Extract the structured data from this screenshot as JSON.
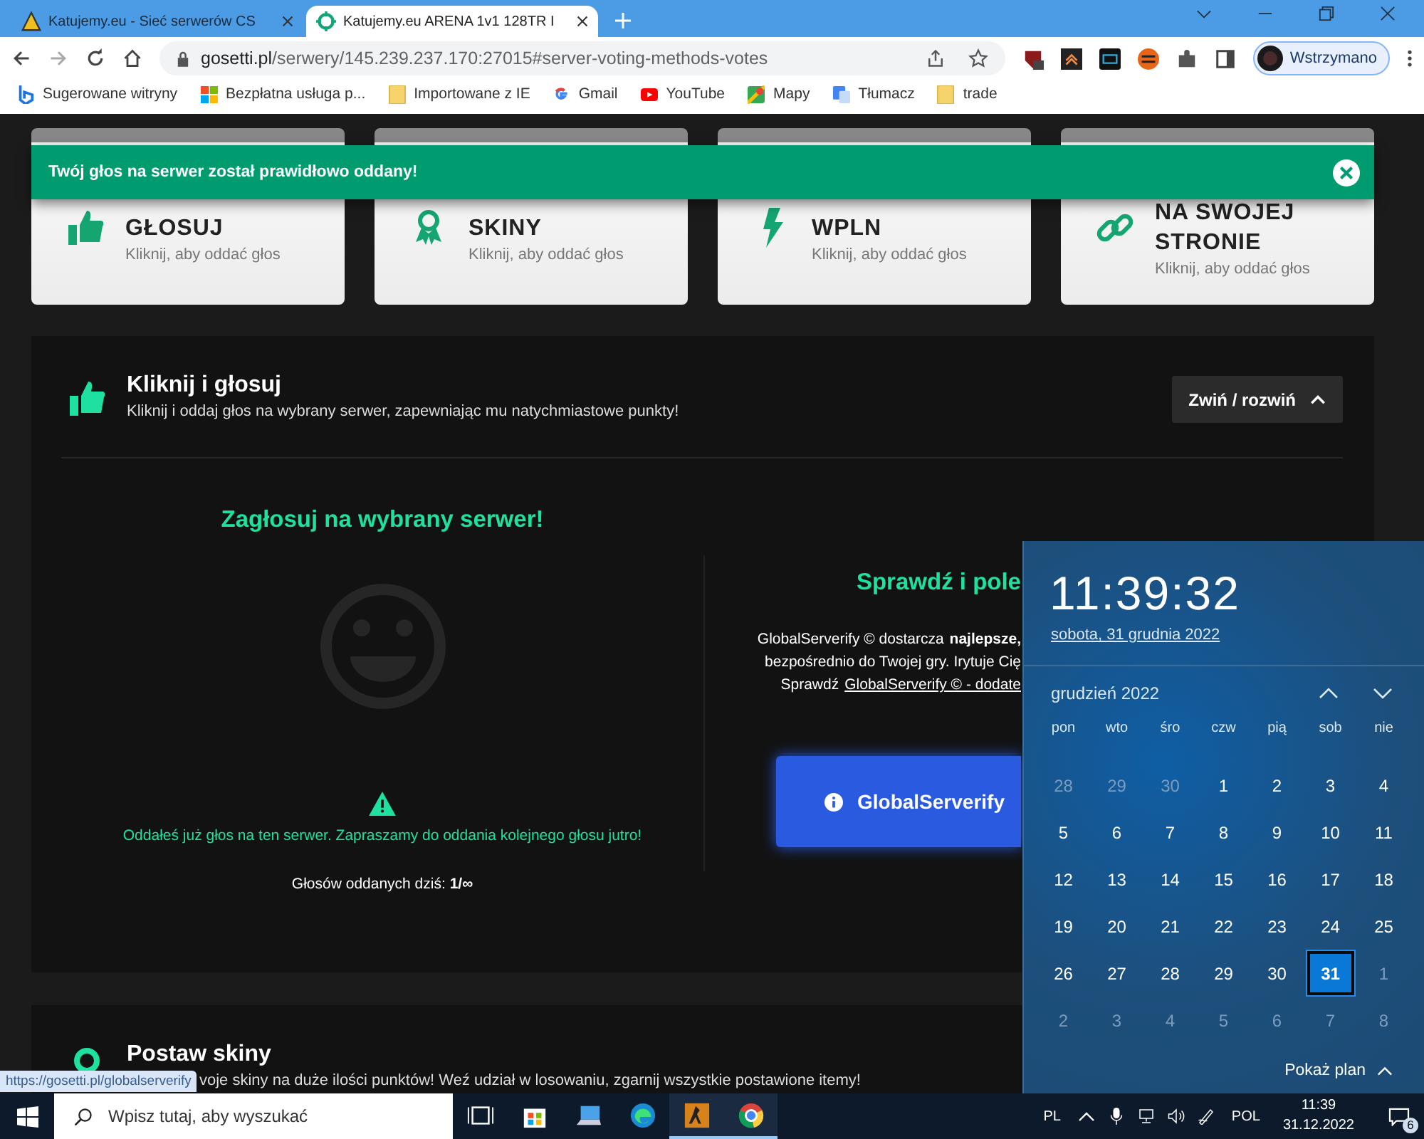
{
  "browser": {
    "tabs": [
      {
        "title": "Katujemy.eu - Sieć serwerów CS",
        "selected": false
      },
      {
        "title": "Katujemy.eu ARENA 1v1 128TR I",
        "selected": true
      }
    ],
    "url": {
      "host": "gosetti.pl",
      "path": "/serwery/145.239.237.170:27015#server-voting-methods-votes"
    },
    "profile": "Wstrzymano",
    "bookmarks": [
      "Sugerowane witryny",
      "Bezpłatna usługa p...",
      "Importowane z IE",
      "Gmail",
      "YouTube",
      "Mapy",
      "Tłumacz",
      "trade"
    ]
  },
  "toast": {
    "message": "Twój głos na serwer został prawidłowo oddany!"
  },
  "methods": [
    {
      "title": "GŁOSUJ",
      "subtitle": "Kliknij, aby oddać głos"
    },
    {
      "title": "SKINY",
      "subtitle": "Kliknij, aby oddać głos"
    },
    {
      "title": "WPLN",
      "subtitle": "Kliknij, aby oddać głos"
    },
    {
      "title": "NA SWOJEJ STRONIE",
      "subtitle": "Kliknij, aby oddać głos"
    }
  ],
  "vote_section": {
    "title": "Kliknij i głosuj",
    "subtitle": "Kliknij i oddaj głos na wybrany serwer, zapewniając mu natychmiastowe punkty!",
    "toggle": "Zwiń / rozwiń",
    "left": {
      "heading": "Zagłosuj na wybrany serwer!",
      "notice": "Oddałeś już głos na ten serwer. Zapraszamy do oddania kolejnego głosu jutro!",
      "count": "Głosów oddanych dziś: **1/∞**"
    },
    "right": {
      "heading": "Sprawdź i pole",
      "lines": [
        "GlobalServerify © dostarcza **najlepsze,**",
        "bezpośrednio do Twojej gry. Irytuje Cię"
      ],
      "link_prefix": "Sprawdź",
      "link": "GlobalServerify © - dodate",
      "button": "GlobalServerify"
    }
  },
  "skins_section": {
    "title": "Postaw skiny",
    "subtitle": "voje skiny na duże ilości punktów! Weź udział w losowaniu, zgarnij wszystkie postawione itemy!"
  },
  "status_url": "https://gosetti.pl/globalserverify",
  "calendar": {
    "time": "11:39:32",
    "date": "sobota, 31 grudnia 2022",
    "month": "grudzień 2022",
    "weekdays": [
      "pon",
      "wto",
      "śro",
      "czw",
      "pią",
      "sob",
      "nie"
    ],
    "weeks": [
      [
        {
          "label": "28",
          "in_month": false,
          "selected": false
        },
        {
          "label": "29",
          "in_month": false,
          "selected": false
        },
        {
          "label": "30",
          "in_month": false,
          "selected": false
        },
        {
          "label": "1",
          "in_month": true,
          "selected": false
        },
        {
          "label": "2",
          "in_month": true,
          "selected": false
        },
        {
          "label": "3",
          "in_month": true,
          "selected": false
        },
        {
          "label": "4",
          "in_month": true,
          "selected": false
        }
      ],
      [
        {
          "label": "5",
          "in_month": true,
          "selected": false
        },
        {
          "label": "6",
          "in_month": true,
          "selected": false
        },
        {
          "label": "7",
          "in_month": true,
          "selected": false
        },
        {
          "label": "8",
          "in_month": true,
          "selected": false
        },
        {
          "label": "9",
          "in_month": true,
          "selected": false
        },
        {
          "label": "10",
          "in_month": true,
          "selected": false
        },
        {
          "label": "11",
          "in_month": true,
          "selected": false
        }
      ],
      [
        {
          "label": "12",
          "in_month": true,
          "selected": false
        },
        {
          "label": "13",
          "in_month": true,
          "selected": false
        },
        {
          "label": "14",
          "in_month": true,
          "selected": false
        },
        {
          "label": "15",
          "in_month": true,
          "selected": false
        },
        {
          "label": "16",
          "in_month": true,
          "selected": false
        },
        {
          "label": "17",
          "in_month": true,
          "selected": false
        },
        {
          "label": "18",
          "in_month": true,
          "selected": false
        }
      ],
      [
        {
          "label": "19",
          "in_month": true,
          "selected": false
        },
        {
          "label": "20",
          "in_month": true,
          "selected": false
        },
        {
          "label": "21",
          "in_month": true,
          "selected": false
        },
        {
          "label": "22",
          "in_month": true,
          "selected": false
        },
        {
          "label": "23",
          "in_month": true,
          "selected": false
        },
        {
          "label": "24",
          "in_month": true,
          "selected": false
        },
        {
          "label": "25",
          "in_month": true,
          "selected": false
        }
      ],
      [
        {
          "label": "26",
          "in_month": true,
          "selected": false
        },
        {
          "label": "27",
          "in_month": true,
          "selected": false
        },
        {
          "label": "28",
          "in_month": true,
          "selected": false
        },
        {
          "label": "29",
          "in_month": true,
          "selected": false
        },
        {
          "label": "30",
          "in_month": true,
          "selected": false
        },
        {
          "label": "31",
          "in_month": true,
          "selected": true
        },
        {
          "label": "1",
          "in_month": false,
          "selected": false
        }
      ],
      [
        {
          "label": "2",
          "in_month": false,
          "selected": false
        },
        {
          "label": "3",
          "in_month": false,
          "selected": false
        },
        {
          "label": "4",
          "in_month": false,
          "selected": false
        },
        {
          "label": "5",
          "in_month": false,
          "selected": false
        },
        {
          "label": "6",
          "in_month": false,
          "selected": false
        },
        {
          "label": "7",
          "in_month": false,
          "selected": false
        },
        {
          "label": "8",
          "in_month": false,
          "selected": false
        }
      ]
    ],
    "footer": "Pokaż plan"
  },
  "taskbar": {
    "search": {
      "placeholder": "Wpisz tutaj, aby wyszukać"
    },
    "apps": [
      {
        "running": false
      },
      {
        "running": false
      },
      {
        "running": false
      },
      {
        "running": false
      },
      {
        "running": true
      },
      {
        "running": true
      }
    ],
    "keyboard": "PL",
    "language": "POL",
    "time": "11:39",
    "date": "31.12.2022",
    "notifications": "6"
  }
}
